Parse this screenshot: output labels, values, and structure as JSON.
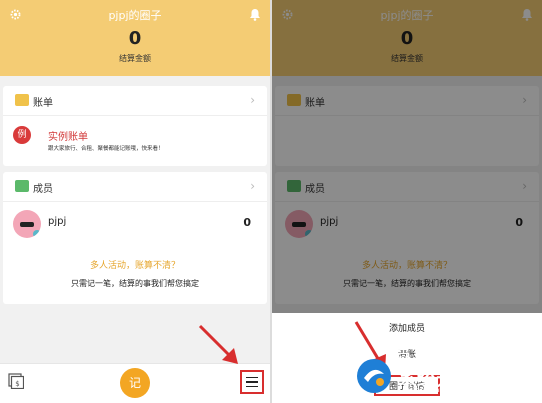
{
  "header": {
    "title": "pjpj的圈子",
    "amount": "0",
    "amount_label": "结算金额"
  },
  "bill_section": {
    "label": "账单",
    "example_badge": "例",
    "example_title": "实例账单",
    "example_desc": "跟大家旅行、合租、聚餐都能记账哦，快来看！"
  },
  "members_section": {
    "label": "成员",
    "members": [
      {
        "name": "pjpj",
        "amount": "0"
      }
    ],
    "promo_title": "多人活动，账算不清？",
    "promo_desc": "只需记一笔，结算的事我们帮您搞定"
  },
  "bottom_bar": {
    "record_label": "记"
  },
  "menu_sheet": {
    "options": [
      "添加成员",
      "清账",
      "圈子详情"
    ]
  },
  "watermark": {
    "site_text": "当下软件园",
    "brand_text": "系统天地",
    "domain_text": "XiTongTianDi.net"
  },
  "colors": {
    "header_bg": "#f4cc74",
    "accent_orange": "#f3a623",
    "highlight_red": "#d82e2e",
    "example_red": "#d93a3a",
    "promo_yellow": "#e6a62d"
  }
}
